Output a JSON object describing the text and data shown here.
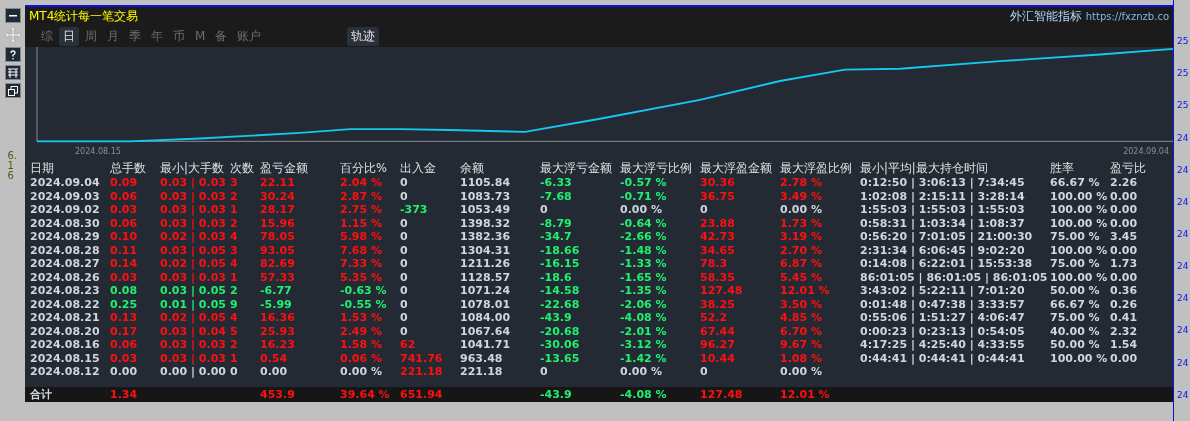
{
  "title": "MT4统计每一笔交易",
  "brand": {
    "name": "外汇智能指标",
    "url": "https://fxznzb.co"
  },
  "tabs": [
    {
      "label": "综",
      "selected": false
    },
    {
      "label": "日",
      "selected": true
    },
    {
      "label": "周",
      "selected": false
    },
    {
      "label": "月",
      "selected": false
    },
    {
      "label": "季",
      "selected": false
    },
    {
      "label": "年",
      "selected": false
    },
    {
      "label": "币",
      "selected": false
    },
    {
      "label": "M",
      "selected": false
    },
    {
      "label": "备",
      "selected": false
    },
    {
      "label": "账户",
      "selected": false
    }
  ],
  "track_button": {
    "label": "轨迹",
    "selected": true
  },
  "chart": {
    "start_date": "2024.08.15",
    "end_date": "2024.09.04"
  },
  "price_axis": [
    "25",
    "25",
    "25",
    "24",
    "24",
    "24",
    "24",
    "24",
    "24",
    "24",
    "24",
    "24"
  ],
  "side_label": "6.16",
  "columns": [
    "日期",
    "总手数",
    "最小|大手数",
    "次数",
    "盈亏金额",
    "百分比%",
    "出入金",
    "余额",
    "最大浮亏金额",
    "最大浮亏比例",
    "最大浮盈金额",
    "最大浮盈比例",
    "最小|平均|最大持仓时间",
    "胜率",
    "盈亏比"
  ],
  "rows": [
    {
      "cells": [
        {
          "text": "2024.09.04",
          "color": "#d0d6de"
        },
        {
          "text": "0.09",
          "color": "#ff1010"
        },
        {
          "text": "0.03 | 0.03",
          "color": "#ff1010"
        },
        {
          "text": "3",
          "color": "#ff1010"
        },
        {
          "text": "22.11",
          "color": "#ff1010"
        },
        {
          "text": "2.04 %",
          "color": "#ff1010"
        },
        {
          "text": "0",
          "color": "#d0d6de"
        },
        {
          "text": "1105.84",
          "color": "#d0d6de"
        },
        {
          "text": "-6.33",
          "color": "#20f070"
        },
        {
          "text": "-0.57 %",
          "color": "#20f070"
        },
        {
          "text": "30.36",
          "color": "#ff1010"
        },
        {
          "text": "2.78 %",
          "color": "#ff1010"
        },
        {
          "text": "0:12:50 | 3:06:13 | 7:34:45",
          "color": "#d0d6de"
        },
        {
          "text": "66.67 %",
          "color": "#d0d6de"
        },
        {
          "text": "2.26",
          "color": "#d0d6de"
        }
      ]
    },
    {
      "cells": [
        {
          "text": "2024.09.03",
          "color": "#d0d6de"
        },
        {
          "text": "0.06",
          "color": "#ff1010"
        },
        {
          "text": "0.03 | 0.03",
          "color": "#ff1010"
        },
        {
          "text": "2",
          "color": "#ff1010"
        },
        {
          "text": "30.24",
          "color": "#ff1010"
        },
        {
          "text": "2.87 %",
          "color": "#ff1010"
        },
        {
          "text": "0",
          "color": "#d0d6de"
        },
        {
          "text": "1083.73",
          "color": "#d0d6de"
        },
        {
          "text": "-7.68",
          "color": "#20f070"
        },
        {
          "text": "-0.71 %",
          "color": "#20f070"
        },
        {
          "text": "36.75",
          "color": "#ff1010"
        },
        {
          "text": "3.49 %",
          "color": "#ff1010"
        },
        {
          "text": "1:02:08 | 2:15:11 | 3:28:14",
          "color": "#d0d6de"
        },
        {
          "text": "100.00 %",
          "color": "#d0d6de"
        },
        {
          "text": "0.00",
          "color": "#d0d6de"
        }
      ]
    },
    {
      "cells": [
        {
          "text": "2024.09.02",
          "color": "#d0d6de"
        },
        {
          "text": "0.03",
          "color": "#ff1010"
        },
        {
          "text": "0.03 | 0.03",
          "color": "#ff1010"
        },
        {
          "text": "1",
          "color": "#ff1010"
        },
        {
          "text": "28.17",
          "color": "#ff1010"
        },
        {
          "text": "2.75 %",
          "color": "#ff1010"
        },
        {
          "text": "-373",
          "color": "#20f070"
        },
        {
          "text": "1053.49",
          "color": "#d0d6de"
        },
        {
          "text": "0",
          "color": "#d0d6de"
        },
        {
          "text": "0.00 %",
          "color": "#d0d6de"
        },
        {
          "text": "0",
          "color": "#d0d6de"
        },
        {
          "text": "0.00 %",
          "color": "#d0d6de"
        },
        {
          "text": "1:55:03 | 1:55:03 | 1:55:03",
          "color": "#d0d6de"
        },
        {
          "text": "100.00 %",
          "color": "#d0d6de"
        },
        {
          "text": "0.00",
          "color": "#d0d6de"
        }
      ]
    },
    {
      "cells": [
        {
          "text": "2024.08.30",
          "color": "#d0d6de"
        },
        {
          "text": "0.06",
          "color": "#ff1010"
        },
        {
          "text": "0.03 | 0.03",
          "color": "#ff1010"
        },
        {
          "text": "2",
          "color": "#ff1010"
        },
        {
          "text": "15.96",
          "color": "#ff1010"
        },
        {
          "text": "1.15 %",
          "color": "#ff1010"
        },
        {
          "text": "0",
          "color": "#d0d6de"
        },
        {
          "text": "1398.32",
          "color": "#d0d6de"
        },
        {
          "text": "-8.79",
          "color": "#20f070"
        },
        {
          "text": "-0.64 %",
          "color": "#20f070"
        },
        {
          "text": "23.88",
          "color": "#ff1010"
        },
        {
          "text": "1.73 %",
          "color": "#ff1010"
        },
        {
          "text": "0:58:31 | 1:03:34 | 1:08:37",
          "color": "#d0d6de"
        },
        {
          "text": "100.00 %",
          "color": "#d0d6de"
        },
        {
          "text": "0.00",
          "color": "#d0d6de"
        }
      ]
    },
    {
      "cells": [
        {
          "text": "2024.08.29",
          "color": "#d0d6de"
        },
        {
          "text": "0.10",
          "color": "#ff1010"
        },
        {
          "text": "0.02 | 0.03",
          "color": "#ff1010"
        },
        {
          "text": "4",
          "color": "#ff1010"
        },
        {
          "text": "78.05",
          "color": "#ff1010"
        },
        {
          "text": "5.98 %",
          "color": "#ff1010"
        },
        {
          "text": "0",
          "color": "#d0d6de"
        },
        {
          "text": "1382.36",
          "color": "#d0d6de"
        },
        {
          "text": "-34.7",
          "color": "#20f070"
        },
        {
          "text": "-2.66 %",
          "color": "#20f070"
        },
        {
          "text": "42.73",
          "color": "#ff1010"
        },
        {
          "text": "3.19 %",
          "color": "#ff1010"
        },
        {
          "text": "0:56:20 | 7:01:05 | 21:00:30",
          "color": "#d0d6de"
        },
        {
          "text": "75.00 %",
          "color": "#d0d6de"
        },
        {
          "text": "3.45",
          "color": "#d0d6de"
        }
      ]
    },
    {
      "cells": [
        {
          "text": "2024.08.28",
          "color": "#d0d6de"
        },
        {
          "text": "0.11",
          "color": "#ff1010"
        },
        {
          "text": "0.03 | 0.05",
          "color": "#ff1010"
        },
        {
          "text": "3",
          "color": "#ff1010"
        },
        {
          "text": "93.05",
          "color": "#ff1010"
        },
        {
          "text": "7.68 %",
          "color": "#ff1010"
        },
        {
          "text": "0",
          "color": "#d0d6de"
        },
        {
          "text": "1304.31",
          "color": "#d0d6de"
        },
        {
          "text": "-18.66",
          "color": "#20f070"
        },
        {
          "text": "-1.48 %",
          "color": "#20f070"
        },
        {
          "text": "34.65",
          "color": "#ff1010"
        },
        {
          "text": "2.70 %",
          "color": "#ff1010"
        },
        {
          "text": "2:31:34 | 6:06:45 | 9:02:20",
          "color": "#d0d6de"
        },
        {
          "text": "100.00 %",
          "color": "#d0d6de"
        },
        {
          "text": "0.00",
          "color": "#d0d6de"
        }
      ]
    },
    {
      "cells": [
        {
          "text": "2024.08.27",
          "color": "#d0d6de"
        },
        {
          "text": "0.14",
          "color": "#ff1010"
        },
        {
          "text": "0.02 | 0.05",
          "color": "#ff1010"
        },
        {
          "text": "4",
          "color": "#ff1010"
        },
        {
          "text": "82.69",
          "color": "#ff1010"
        },
        {
          "text": "7.33 %",
          "color": "#ff1010"
        },
        {
          "text": "0",
          "color": "#d0d6de"
        },
        {
          "text": "1211.26",
          "color": "#d0d6de"
        },
        {
          "text": "-16.15",
          "color": "#20f070"
        },
        {
          "text": "-1.33 %",
          "color": "#20f070"
        },
        {
          "text": "78.3",
          "color": "#ff1010"
        },
        {
          "text": "6.87 %",
          "color": "#ff1010"
        },
        {
          "text": "0:14:08 | 6:22:01 | 15:53:38",
          "color": "#d0d6de"
        },
        {
          "text": "75.00 %",
          "color": "#d0d6de"
        },
        {
          "text": "1.73",
          "color": "#d0d6de"
        }
      ]
    },
    {
      "cells": [
        {
          "text": "2024.08.26",
          "color": "#d0d6de"
        },
        {
          "text": "0.03",
          "color": "#ff1010"
        },
        {
          "text": "0.03 | 0.03",
          "color": "#ff1010"
        },
        {
          "text": "1",
          "color": "#ff1010"
        },
        {
          "text": "57.33",
          "color": "#ff1010"
        },
        {
          "text": "5.35 %",
          "color": "#ff1010"
        },
        {
          "text": "0",
          "color": "#d0d6de"
        },
        {
          "text": "1128.57",
          "color": "#d0d6de"
        },
        {
          "text": "-18.6",
          "color": "#20f070"
        },
        {
          "text": "-1.65 %",
          "color": "#20f070"
        },
        {
          "text": "58.35",
          "color": "#ff1010"
        },
        {
          "text": "5.45 %",
          "color": "#ff1010"
        },
        {
          "text": "86:01:05 | 86:01:05 | 86:01:05",
          "color": "#d0d6de"
        },
        {
          "text": "100.00 %",
          "color": "#d0d6de"
        },
        {
          "text": "0.00",
          "color": "#d0d6de"
        }
      ]
    },
    {
      "cells": [
        {
          "text": "2024.08.23",
          "color": "#d0d6de"
        },
        {
          "text": "0.08",
          "color": "#20f070"
        },
        {
          "text": "0.03 | 0.05",
          "color": "#20f070"
        },
        {
          "text": "2",
          "color": "#20f070"
        },
        {
          "text": "-6.77",
          "color": "#20f070"
        },
        {
          "text": "-0.63 %",
          "color": "#20f070"
        },
        {
          "text": "0",
          "color": "#d0d6de"
        },
        {
          "text": "1071.24",
          "color": "#d0d6de"
        },
        {
          "text": "-14.58",
          "color": "#20f070"
        },
        {
          "text": "-1.35 %",
          "color": "#20f070"
        },
        {
          "text": "127.48",
          "color": "#ff1010"
        },
        {
          "text": "12.01 %",
          "color": "#ff1010"
        },
        {
          "text": "3:43:02 | 5:22:11 | 7:01:20",
          "color": "#d0d6de"
        },
        {
          "text": "50.00 %",
          "color": "#d0d6de"
        },
        {
          "text": "0.36",
          "color": "#d0d6de"
        }
      ]
    },
    {
      "cells": [
        {
          "text": "2024.08.22",
          "color": "#d0d6de"
        },
        {
          "text": "0.25",
          "color": "#20f070"
        },
        {
          "text": "0.01 | 0.05",
          "color": "#20f070"
        },
        {
          "text": "9",
          "color": "#20f070"
        },
        {
          "text": "-5.99",
          "color": "#20f070"
        },
        {
          "text": "-0.55 %",
          "color": "#20f070"
        },
        {
          "text": "0",
          "color": "#d0d6de"
        },
        {
          "text": "1078.01",
          "color": "#d0d6de"
        },
        {
          "text": "-22.68",
          "color": "#20f070"
        },
        {
          "text": "-2.06 %",
          "color": "#20f070"
        },
        {
          "text": "38.25",
          "color": "#ff1010"
        },
        {
          "text": "3.50 %",
          "color": "#ff1010"
        },
        {
          "text": "0:01:48 | 0:47:38 | 3:33:57",
          "color": "#d0d6de"
        },
        {
          "text": "66.67 %",
          "color": "#d0d6de"
        },
        {
          "text": "0.26",
          "color": "#d0d6de"
        }
      ]
    },
    {
      "cells": [
        {
          "text": "2024.08.21",
          "color": "#d0d6de"
        },
        {
          "text": "0.13",
          "color": "#ff1010"
        },
        {
          "text": "0.02 | 0.05",
          "color": "#ff1010"
        },
        {
          "text": "4",
          "color": "#ff1010"
        },
        {
          "text": "16.36",
          "color": "#ff1010"
        },
        {
          "text": "1.53 %",
          "color": "#ff1010"
        },
        {
          "text": "0",
          "color": "#d0d6de"
        },
        {
          "text": "1084.00",
          "color": "#d0d6de"
        },
        {
          "text": "-43.9",
          "color": "#20f070"
        },
        {
          "text": "-4.08 %",
          "color": "#20f070"
        },
        {
          "text": "52.2",
          "color": "#ff1010"
        },
        {
          "text": "4.85 %",
          "color": "#ff1010"
        },
        {
          "text": "0:55:06 | 1:51:27 | 4:06:47",
          "color": "#d0d6de"
        },
        {
          "text": "75.00 %",
          "color": "#d0d6de"
        },
        {
          "text": "0.41",
          "color": "#d0d6de"
        }
      ]
    },
    {
      "cells": [
        {
          "text": "2024.08.20",
          "color": "#d0d6de"
        },
        {
          "text": "0.17",
          "color": "#ff1010"
        },
        {
          "text": "0.03 | 0.04",
          "color": "#ff1010"
        },
        {
          "text": "5",
          "color": "#ff1010"
        },
        {
          "text": "25.93",
          "color": "#ff1010"
        },
        {
          "text": "2.49 %",
          "color": "#ff1010"
        },
        {
          "text": "0",
          "color": "#d0d6de"
        },
        {
          "text": "1067.64",
          "color": "#d0d6de"
        },
        {
          "text": "-20.68",
          "color": "#20f070"
        },
        {
          "text": "-2.01 %",
          "color": "#20f070"
        },
        {
          "text": "67.44",
          "color": "#ff1010"
        },
        {
          "text": "6.70 %",
          "color": "#ff1010"
        },
        {
          "text": "0:00:23 | 0:23:13 | 0:54:05",
          "color": "#d0d6de"
        },
        {
          "text": "40.00 %",
          "color": "#d0d6de"
        },
        {
          "text": "2.32",
          "color": "#d0d6de"
        }
      ]
    },
    {
      "cells": [
        {
          "text": "2024.08.16",
          "color": "#d0d6de"
        },
        {
          "text": "0.06",
          "color": "#ff1010"
        },
        {
          "text": "0.03 | 0.03",
          "color": "#ff1010"
        },
        {
          "text": "2",
          "color": "#ff1010"
        },
        {
          "text": "16.23",
          "color": "#ff1010"
        },
        {
          "text": "1.58 %",
          "color": "#ff1010"
        },
        {
          "text": "62",
          "color": "#ff1010"
        },
        {
          "text": "1041.71",
          "color": "#d0d6de"
        },
        {
          "text": "-30.06",
          "color": "#20f070"
        },
        {
          "text": "-3.12 %",
          "color": "#20f070"
        },
        {
          "text": "96.27",
          "color": "#ff1010"
        },
        {
          "text": "9.67 %",
          "color": "#ff1010"
        },
        {
          "text": "4:17:25 | 4:25:40 | 4:33:55",
          "color": "#d0d6de"
        },
        {
          "text": "50.00 %",
          "color": "#d0d6de"
        },
        {
          "text": "1.54",
          "color": "#d0d6de"
        }
      ]
    },
    {
      "cells": [
        {
          "text": "2024.08.15",
          "color": "#d0d6de"
        },
        {
          "text": "0.03",
          "color": "#ff1010"
        },
        {
          "text": "0.03 | 0.03",
          "color": "#ff1010"
        },
        {
          "text": "1",
          "color": "#ff1010"
        },
        {
          "text": "0.54",
          "color": "#ff1010"
        },
        {
          "text": "0.06 %",
          "color": "#ff1010"
        },
        {
          "text": "741.76",
          "color": "#ff1010"
        },
        {
          "text": "963.48",
          "color": "#d0d6de"
        },
        {
          "text": "-13.65",
          "color": "#20f070"
        },
        {
          "text": "-1.42 %",
          "color": "#20f070"
        },
        {
          "text": "10.44",
          "color": "#ff1010"
        },
        {
          "text": "1.08 %",
          "color": "#ff1010"
        },
        {
          "text": "0:44:41 | 0:44:41 | 0:44:41",
          "color": "#d0d6de"
        },
        {
          "text": "100.00 %",
          "color": "#d0d6de"
        },
        {
          "text": "0.00",
          "color": "#d0d6de"
        }
      ]
    },
    {
      "cells": [
        {
          "text": "2024.08.12",
          "color": "#d0d6de"
        },
        {
          "text": "0.00",
          "color": "#d0d6de"
        },
        {
          "text": "0.00 | 0.00",
          "color": "#d0d6de"
        },
        {
          "text": "0",
          "color": "#d0d6de"
        },
        {
          "text": "0.00",
          "color": "#d0d6de"
        },
        {
          "text": "0.00 %",
          "color": "#d0d6de"
        },
        {
          "text": "221.18",
          "color": "#ff1010"
        },
        {
          "text": "221.18",
          "color": "#d0d6de"
        },
        {
          "text": "0",
          "color": "#d0d6de"
        },
        {
          "text": "0.00 %",
          "color": "#d0d6de"
        },
        {
          "text": "0",
          "color": "#d0d6de"
        },
        {
          "text": "0.00 %",
          "color": "#d0d6de"
        }
      ]
    }
  ],
  "total": {
    "label": {
      "text": "合计",
      "color": "#d0d6de"
    },
    "lots": {
      "text": "1.34",
      "color": "#ff1010"
    },
    "profit": {
      "text": "453.9",
      "color": "#ff1010"
    },
    "percent": {
      "text": "39.64 %",
      "color": "#ff1010"
    },
    "deposit": {
      "text": "651.94",
      "color": "#ff1010"
    },
    "max_float_loss": {
      "text": "-43.9",
      "color": "#20f070"
    },
    "max_float_loss_pct": {
      "text": "-4.08 %",
      "color": "#20f070"
    },
    "max_float_profit": {
      "text": "127.48",
      "color": "#ff1010"
    },
    "max_float_profit_pct": {
      "text": "12.01 %",
      "color": "#ff1010"
    }
  }
}
